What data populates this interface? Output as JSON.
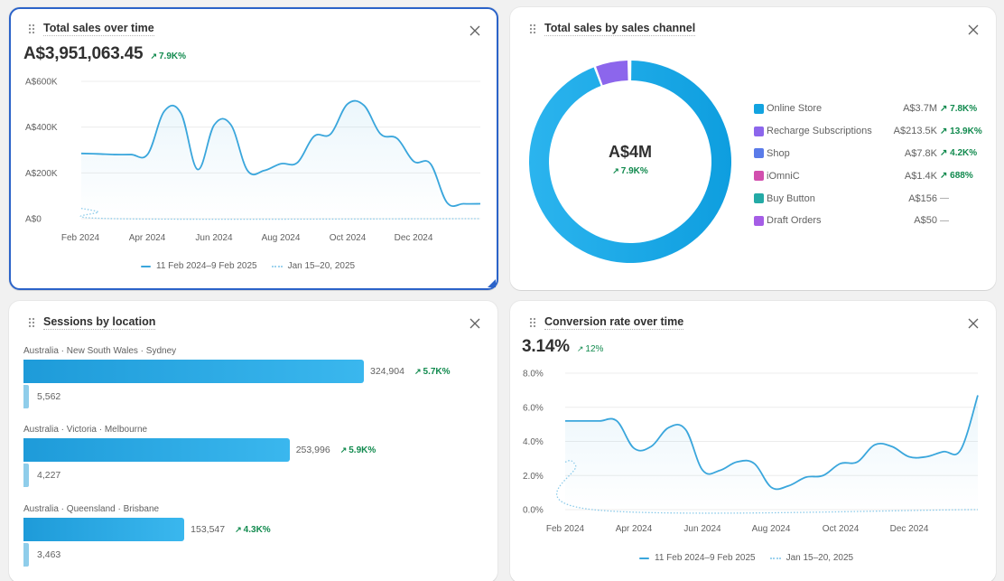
{
  "cards": {
    "sales_over_time": {
      "title": "Total sales over time",
      "value": "A$3,951,063.45",
      "delta": "7.9K%",
      "legend": [
        "11 Feb 2024–9 Feb 2025",
        "Jan 15–20, 2025"
      ]
    },
    "sales_by_channel": {
      "title": "Total sales by sales channel",
      "center_value": "A$4M",
      "center_delta": "7.9K%"
    },
    "sessions_by_location": {
      "title": "Sessions by location"
    },
    "conversion_rate": {
      "title": "Conversion rate over time",
      "value": "3.14%",
      "delta": "12%",
      "legend": [
        "11 Feb 2024–9 Feb 2025",
        "Jan 15–20, 2025"
      ]
    }
  },
  "icons": {
    "drag": "drag-handle-icon",
    "close": "close-icon",
    "arrow_up": "arrow-up-right-icon"
  },
  "colors": {
    "accent": "#2b63c9",
    "line": "#3aa6dc",
    "positive": "#118a4e"
  },
  "chart_data": [
    {
      "type": "area",
      "title": "Total sales over time",
      "xlabel": "",
      "ylabel": "",
      "x_ticks": [
        "Feb 2024",
        "Apr 2024",
        "Jun 2024",
        "Aug 2024",
        "Oct 2024",
        "Dec 2024"
      ],
      "y_ticks": [
        "A$0",
        "A$200K",
        "A$400K",
        "A$600K"
      ],
      "ylim": [
        0,
        600000
      ],
      "grid": true,
      "legend_position": "bottom",
      "series": [
        {
          "name": "11 Feb 2024–9 Feb 2025",
          "style": "solid",
          "x": [
            0,
            0.5,
            1,
            1.5,
            2,
            2.5,
            3,
            3.5,
            4,
            4.5,
            5,
            5.5,
            6,
            6.5,
            7,
            7.5,
            8,
            8.5,
            9,
            9.5,
            10,
            10.5,
            11,
            11.5,
            12
          ],
          "values": [
            285000,
            283000,
            280000,
            280000,
            282000,
            470000,
            460000,
            215000,
            410000,
            410000,
            210000,
            210000,
            240000,
            245000,
            360000,
            370000,
            500000,
            495000,
            370000,
            350000,
            250000,
            240000,
            70000,
            65000,
            65000
          ]
        },
        {
          "name": "Jan 15–20, 2025",
          "style": "dotted",
          "x": [
            0,
            0.5,
            1,
            12
          ],
          "values": [
            45000,
            30000,
            0,
            0
          ]
        }
      ]
    },
    {
      "type": "pie",
      "title": "Total sales by sales channel",
      "center_label": "A$4M",
      "center_delta": "7.9K%",
      "legend_position": "right",
      "slices": [
        {
          "name": "Online Store",
          "value": 3700000,
          "display": "A$3.7M",
          "delta": "7.8K%",
          "color": "#12a3e0"
        },
        {
          "name": "Recharge Subscriptions",
          "value": 213500,
          "display": "A$213.5K",
          "delta": "13.9K%",
          "color": "#8c66ec"
        },
        {
          "name": "Shop",
          "value": 7800,
          "display": "A$7.8K",
          "delta": "4.2K%",
          "color": "#5a7be9"
        },
        {
          "name": "iOmniC",
          "value": 1400,
          "display": "A$1.4K",
          "delta": "688%",
          "color": "#d24fae"
        },
        {
          "name": "Buy Button",
          "value": 156,
          "display": "A$156",
          "delta": "—",
          "color": "#24aaa6"
        },
        {
          "name": "Draft Orders",
          "value": 50,
          "display": "A$50",
          "delta": "—",
          "color": "#a55de6"
        }
      ]
    },
    {
      "type": "bar",
      "title": "Sessions by location",
      "orientation": "horizontal",
      "categories": [
        "Australia · New South Wales · Sydney",
        "Australia · Victoria · Melbourne",
        "Australia · Queensland · Brisbane"
      ],
      "series": [
        {
          "name": "current",
          "values": [
            324904
          ],
          "display": [
            "324,904"
          ],
          "deltas": [
            "5.7K%"
          ]
        },
        {
          "name": "comparison",
          "values": [
            5562
          ],
          "display": [
            "5,562"
          ]
        }
      ],
      "rows": [
        {
          "label": "Australia · New South Wales · Sydney",
          "value": 324904,
          "display": "324,904",
          "delta": "5.7K%",
          "prev_value": 5562,
          "prev_display": "5,562"
        },
        {
          "label": "Australia · Victoria · Melbourne",
          "value": 253996,
          "display": "253,996",
          "delta": "5.9K%",
          "prev_value": 4227,
          "prev_display": "4,227"
        },
        {
          "label": "Australia · Queensland · Brisbane",
          "value": 153547,
          "display": "153,547",
          "delta": "4.3K%",
          "prev_value": 3463,
          "prev_display": "3,463"
        }
      ],
      "xlim": [
        0,
        324904
      ]
    },
    {
      "type": "area",
      "title": "Conversion rate over time",
      "xlabel": "",
      "ylabel": "",
      "x_ticks": [
        "Feb 2024",
        "Apr 2024",
        "Jun 2024",
        "Aug 2024",
        "Oct 2024",
        "Dec 2024"
      ],
      "y_ticks": [
        "0.0%",
        "2.0%",
        "4.0%",
        "6.0%",
        "8.0%"
      ],
      "ylim": [
        0,
        8
      ],
      "grid": true,
      "legend_position": "bottom",
      "series": [
        {
          "name": "11 Feb 2024–9 Feb 2025",
          "style": "solid",
          "x": [
            0,
            0.5,
            1,
            1.5,
            2,
            2.5,
            3,
            3.5,
            4,
            4.5,
            5,
            5.5,
            6,
            6.5,
            7,
            7.5,
            8,
            8.5,
            9,
            9.5,
            10,
            10.5,
            11,
            11.5,
            12
          ],
          "values": [
            5.2,
            5.2,
            5.2,
            5.2,
            3.6,
            3.7,
            4.8,
            4.7,
            2.3,
            2.3,
            2.8,
            2.7,
            1.3,
            1.4,
            1.9,
            2.0,
            2.7,
            2.8,
            3.8,
            3.7,
            3.1,
            3.1,
            3.4,
            3.5,
            6.7
          ]
        },
        {
          "name": "Jan 15–20, 2025",
          "style": "dotted",
          "x": [
            0,
            0.3,
            0.8,
            12
          ],
          "values": [
            2.8,
            2.6,
            0,
            0
          ]
        }
      ]
    }
  ]
}
